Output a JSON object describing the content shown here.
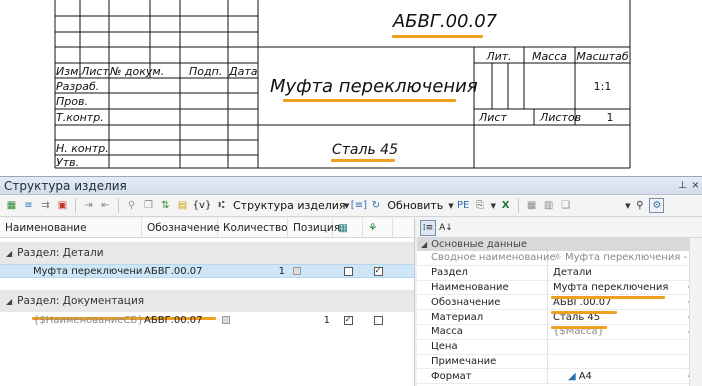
{
  "drawing": {
    "designation": "АБВГ.00.07",
    "name": "Муфта переключения",
    "material": "Сталь 45",
    "headers": {
      "izm": "Изм.",
      "list": "Лист",
      "doc": "№ докум.",
      "sign": "Подп.",
      "date": "Дата"
    },
    "roles": [
      "Разраб.",
      "Пров.",
      "Т.контр.",
      "Н. контр.",
      "Утв."
    ],
    "lit_label": "Лит.",
    "mass_label": "Масса",
    "scale_label": "Масштаб",
    "scale_value": "1:1",
    "sheet_label": "Лист",
    "sheets_label": "Листов",
    "sheets_value": "1",
    "highlight_color": "#f0a020"
  },
  "panel": {
    "title": "Структура изделия",
    "pin": "⊧",
    "close": "×"
  },
  "toolbar": {
    "view_icon_text": "{v}",
    "structure_label": "Структура изделия",
    "refresh_label": "Обновить"
  },
  "grid": {
    "headers": [
      "Наименование",
      "Обозначение",
      "Количество",
      "Позиция"
    ],
    "group_details": "Раздел: Детали",
    "group_docs": "Раздел: Документация",
    "row1": {
      "name": "Муфта переключения",
      "designation": "АБВГ.00.07",
      "qty": "1",
      "pos": "",
      "check1": false,
      "check2": true
    },
    "row2": {
      "name": "{$НаименованиеСБ}",
      "designation": "АБВГ.00.07",
      "qty": "",
      "pos": "1",
      "check1": true,
      "check2": false
    }
  },
  "props": {
    "section": "Основные данные",
    "rows": [
      {
        "name": "Сводное наименование",
        "value": "Муфта переключения - /",
        "grey": true
      },
      {
        "name": "Раздел",
        "value": "Детали",
        "grey": false
      },
      {
        "name": "Наименование",
        "value": "Муфта переключения",
        "grey": false
      },
      {
        "name": "Обозначение",
        "value": "АБВГ.00.07",
        "grey": false
      },
      {
        "name": "Материал",
        "value": "Сталь 45",
        "grey": false
      },
      {
        "name": "Масса",
        "value": "{$Масса}",
        "grey": true
      },
      {
        "name": "Цена",
        "value": "",
        "grey": false
      },
      {
        "name": "Примечание",
        "value": "",
        "grey": false
      },
      {
        "name": "Формат",
        "value": "A4",
        "grey": false
      }
    ]
  }
}
